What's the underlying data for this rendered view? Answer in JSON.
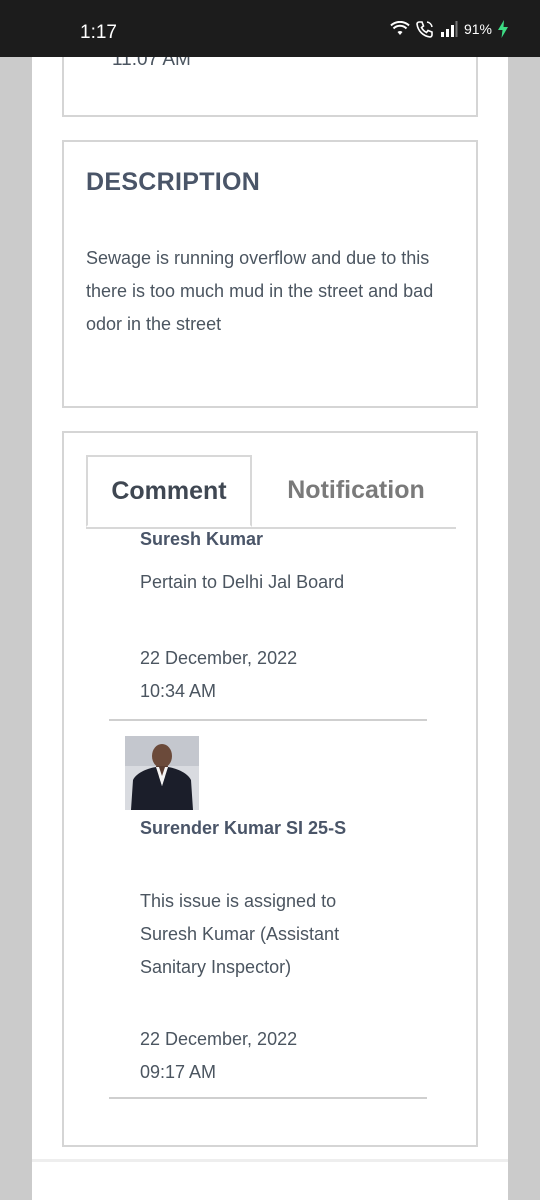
{
  "status_bar": {
    "time": "1:17",
    "battery": "91%",
    "icons": [
      "wifi-icon",
      "wifi-call-icon",
      "signal-icon",
      "charging-icon"
    ]
  },
  "previous_card": {
    "cut_time": "11:07 AM"
  },
  "description": {
    "title": "DESCRIPTION",
    "text": "Sewage is running overflow and due to this there is too much mud in the street and bad odor in the street"
  },
  "tabs": {
    "comment": "Comment",
    "notification": "Notification"
  },
  "comments": [
    {
      "name": "Suresh Kumar",
      "text": "Pertain to Delhi Jal Board",
      "date": "22 December, 2022",
      "time": "10:34 AM"
    },
    {
      "name": "Surender Kumar SI 25-S",
      "text": "This issue is assigned to Suresh Kumar (Assistant Sanitary Inspector)",
      "date": "22 December, 2022",
      "time": "09:17 AM"
    }
  ],
  "colors": {
    "status_bar_bg": "#1c1c1c",
    "text_dark": "#4a5568",
    "border": "#d5d5d5"
  }
}
